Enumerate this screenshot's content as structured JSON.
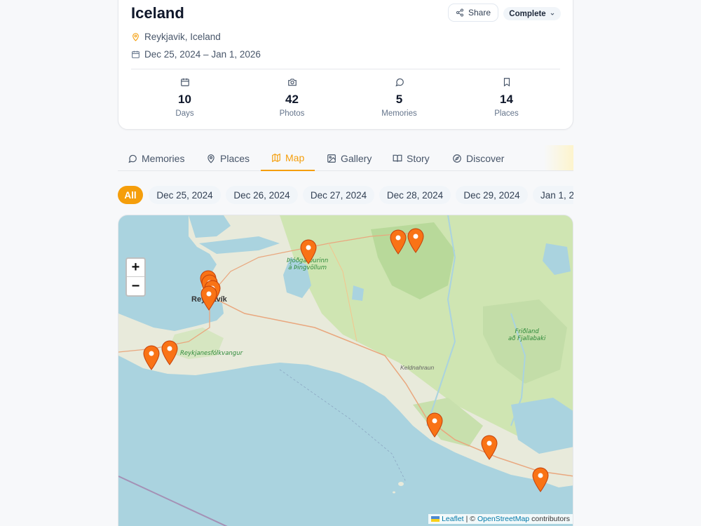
{
  "trip": {
    "title": "Iceland",
    "location": "Reykjavik, Iceland",
    "dates": "Dec 25, 2024 – Jan 1, 2026",
    "share_label": "Share",
    "status_label": "Complete"
  },
  "stats": [
    {
      "icon": "calendar-icon",
      "value": "10",
      "label": "Days"
    },
    {
      "icon": "camera-icon",
      "value": "42",
      "label": "Photos"
    },
    {
      "icon": "message-icon",
      "value": "5",
      "label": "Memories"
    },
    {
      "icon": "bookmark-icon",
      "value": "14",
      "label": "Places"
    }
  ],
  "tabs": [
    {
      "label": "Memories",
      "icon": "message-icon"
    },
    {
      "label": "Places",
      "icon": "map-pin-icon"
    },
    {
      "label": "Map",
      "icon": "map-icon",
      "active": true
    },
    {
      "label": "Gallery",
      "icon": "image-icon"
    },
    {
      "label": "Story",
      "icon": "book-icon"
    },
    {
      "label": "Discover",
      "icon": "compass-icon"
    }
  ],
  "date_chips": [
    "All",
    "Dec 25, 2024",
    "Dec 26, 2024",
    "Dec 27, 2024",
    "Dec 28, 2024",
    "Dec 29, 2024",
    "Jan 1, 2"
  ],
  "map": {
    "zoom_in": "+",
    "zoom_out": "−",
    "labels": {
      "thingvellir_1": "Þjóðgarðurinn",
      "thingvellir_2": "á Þingvöllum",
      "reykjavik": "Reykjavík",
      "reykjanes": "Reykjanesfólkvangur",
      "fjallabak_1": "Friðland",
      "fjallabak_2": "að Fjallabaki",
      "keldnahraun": "Keldnahraun"
    },
    "attribution": {
      "leaflet": "Leaflet",
      "separator": "| ©",
      "osm": "OpenStreetMap",
      "suffix": "contributors"
    },
    "marker_color": "#f97316"
  }
}
